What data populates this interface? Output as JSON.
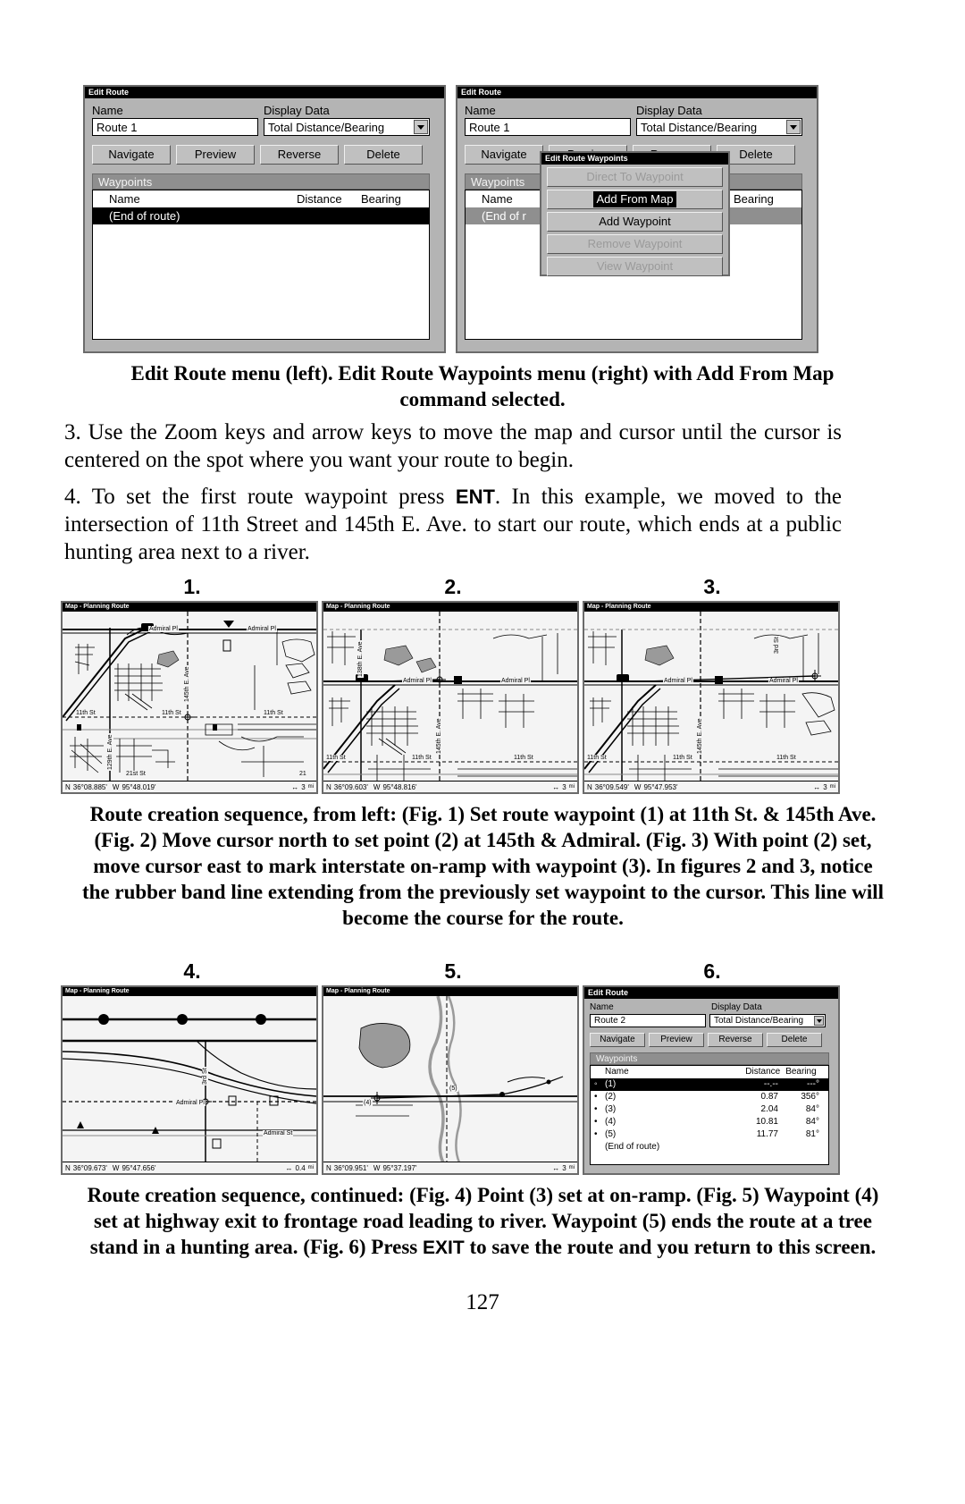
{
  "page_number": "127",
  "top_figures": {
    "left": {
      "window_title": "Edit Route",
      "name_label": "Name",
      "name_value": "Route 1",
      "display_data_label": "Display Data",
      "display_data_value": "Total Distance/Bearing",
      "buttons": [
        "Navigate",
        "Preview",
        "Reverse",
        "Delete"
      ],
      "waypoints_bar": "Waypoints",
      "columns": [
        "Name",
        "Distance",
        "Bearing"
      ],
      "rows": [
        {
          "name": "(End of route)",
          "distance": "",
          "bearing": "",
          "selected": true
        }
      ]
    },
    "right": {
      "window_title": "Edit Route",
      "name_label": "Name",
      "name_value": "Route 1",
      "display_data_label": "Display Data",
      "display_data_value": "Total Distance/Bearing",
      "buttons": [
        "Navigate",
        "Preview",
        "Reverse",
        "Delete"
      ],
      "waypoints_bar": "Waypoints",
      "columns": [
        "Name",
        "Distance",
        "Bearing"
      ],
      "rows": [
        {
          "name": "(End of r",
          "distance": "",
          "bearing": "",
          "selected": false
        }
      ],
      "popup": {
        "title": "Edit Route Waypoints",
        "items": [
          {
            "label": "Direct To Waypoint",
            "state": "disabled"
          },
          {
            "label": "Add From Map",
            "state": "selected"
          },
          {
            "label": "Add Waypoint",
            "state": "enabled"
          },
          {
            "label": "Remove Waypoint",
            "state": "disabled"
          },
          {
            "label": "View Waypoint",
            "state": "disabled"
          }
        ]
      }
    }
  },
  "caption_1": "Edit Route menu (left). Edit Route Waypoints menu (right) with Add From Map command selected.",
  "paragraph_3": "3. Use the Zoom keys and arrow keys to move the map and cursor until the cursor is centered on the spot where you want your route to begin.",
  "paragraph_4_parts": {
    "a": "4. To set the first route waypoint press ",
    "kbd": "ENT",
    "b": ". In this example, we moved to the intersection of 11th Street and 145th E. Ave. to start our route, which ends at a public hunting area next to a river."
  },
  "figure_labels": {
    "f1": "1.",
    "f2": "2.",
    "f3": "3.",
    "f4": "4.",
    "f5": "5.",
    "f6": "6."
  },
  "maps": {
    "f1": {
      "title": "Map - Planning Route",
      "lat": "36°08.885'",
      "lon": "95°48.019'",
      "lat_hemi": "N",
      "lon_hemi": "W",
      "zoom": "3",
      "zoom_unit": "mi",
      "street_labels": [
        "Admiral Pl",
        "Admiral Pl",
        "145th E. Ave",
        "11th St",
        "11th St",
        "11th St",
        "129th E. Ave",
        "21st St",
        "21"
      ]
    },
    "f2": {
      "title": "Map - Planning Route",
      "lat": "36°09.603'",
      "lon": "95°48.816'",
      "lat_hemi": "N",
      "lon_hemi": "W",
      "zoom": "3",
      "zoom_unit": "mi",
      "street_labels": [
        "Admiral Pl",
        "Admiral Pl",
        "145th E. Ave",
        "138th E. Ave",
        "11th St",
        "11th St",
        "11th St"
      ]
    },
    "f3": {
      "title": "Map - Planning Route",
      "lat": "36°09.549'",
      "lon": "95°47.953'",
      "lat_hemi": "N",
      "lon_hemi": "W",
      "zoom": "3",
      "zoom_unit": "mi",
      "street_labels": [
        "Admiral Pl",
        "Admiral Pl",
        "145th E. Ave",
        "3rd St",
        "11th St",
        "11th St",
        "11th St"
      ]
    },
    "f4": {
      "title": "Map - Planning Route",
      "lat": "36°09.673'",
      "lon": "95°47.656'",
      "lat_hemi": "N",
      "lon_hemi": "W",
      "zoom": "0.4",
      "zoom_unit": "mi",
      "street_labels": [
        "Admiral Pl",
        "Admiral St",
        "3rd St"
      ]
    },
    "f5": {
      "title": "Map - Planning Route",
      "lat": "36°09.951'",
      "lon": "95°37.197'",
      "lat_hemi": "N",
      "lon_hemi": "W",
      "zoom": "3",
      "zoom_unit": "mi",
      "street_labels": [
        "(4)",
        "(5)"
      ]
    }
  },
  "figure6": {
    "window_title": "Edit Route",
    "name_label": "Name",
    "name_value": "Route 2",
    "display_data_label": "Display Data",
    "display_data_value": "Total Distance/Bearing",
    "buttons": [
      "Navigate",
      "Preview",
      "Reverse",
      "Delete"
    ],
    "waypoints_bar": "Waypoints",
    "columns": [
      "Name",
      "Distance",
      "Bearing"
    ],
    "rows": [
      {
        "name": "(1)",
        "distance": "--.--",
        "bearing": "---°",
        "selected": true
      },
      {
        "name": "(2)",
        "distance": "0.87",
        "bearing": "356°",
        "selected": false
      },
      {
        "name": "(3)",
        "distance": "2.04",
        "bearing": "84°",
        "selected": false
      },
      {
        "name": "(4)",
        "distance": "10.81",
        "bearing": "84°",
        "selected": false
      },
      {
        "name": "(5)",
        "distance": "11.77",
        "bearing": "81°",
        "selected": false
      },
      {
        "name": "(End of route)",
        "distance": "",
        "bearing": "",
        "selected": false
      }
    ]
  },
  "caption_2": "Route creation sequence, from left: (Fig. 1) Set route waypoint (1) at 11th St. & 145th Ave. (Fig. 2) Move cursor north to set point (2) at 145th & Admiral. (Fig. 3) With point (2) set, move cursor east to mark interstate on-ramp with waypoint (3). In figures 2 and 3, notice the rubber band line extending from the previously set waypoint to the cursor. This line will become the course for the route.",
  "caption_3_parts": {
    "a": "Route creation sequence, continued: (Fig. 4) Point (3) set at on-ramp. (Fig. 5) Waypoint (4) set at highway exit to frontage road leading to river. Waypoint (5) ends the route at a tree stand in a hunting area. (Fig. 6) Press ",
    "kbd": "EXIT",
    "b": " to save the route and you return to this screen."
  }
}
